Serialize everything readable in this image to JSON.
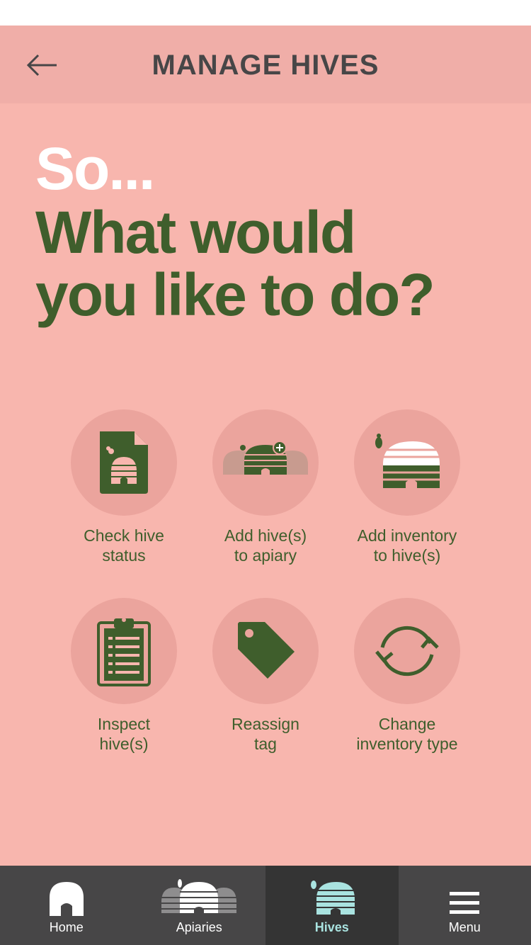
{
  "header": {
    "title": "MANAGE HIVES"
  },
  "headline": {
    "line1": "So...",
    "line2": "What would",
    "line3": "you like to do?"
  },
  "actions": [
    {
      "label": "Check hive\nstatus",
      "icon": "hive-document-icon"
    },
    {
      "label": "Add hive(s)\nto apiary",
      "icon": "add-hive-icon"
    },
    {
      "label": "Add inventory\nto hive(s)",
      "icon": "hive-inventory-icon"
    },
    {
      "label": "Inspect\nhive(s)",
      "icon": "clipboard-icon"
    },
    {
      "label": "Reassign\ntag",
      "icon": "tag-icon"
    },
    {
      "label": "Change\ninventory type",
      "icon": "refresh-icon"
    }
  ],
  "tabbar": {
    "tabs": [
      {
        "label": "Home",
        "icon": "home-icon",
        "active": false
      },
      {
        "label": "Apiaries",
        "icon": "apiaries-icon",
        "active": false
      },
      {
        "label": "Hives",
        "icon": "hive-icon",
        "active": true
      },
      {
        "label": "Menu",
        "icon": "hamburger-menu-icon",
        "active": false
      }
    ]
  },
  "colors": {
    "background": "#f8b6ae",
    "header": "#f0aea8",
    "circle": "#eba49d",
    "green": "#3f5e2c",
    "tabbar": "#474647",
    "tab_active": "#343434",
    "tab_active_text": "#a9e3e0"
  }
}
